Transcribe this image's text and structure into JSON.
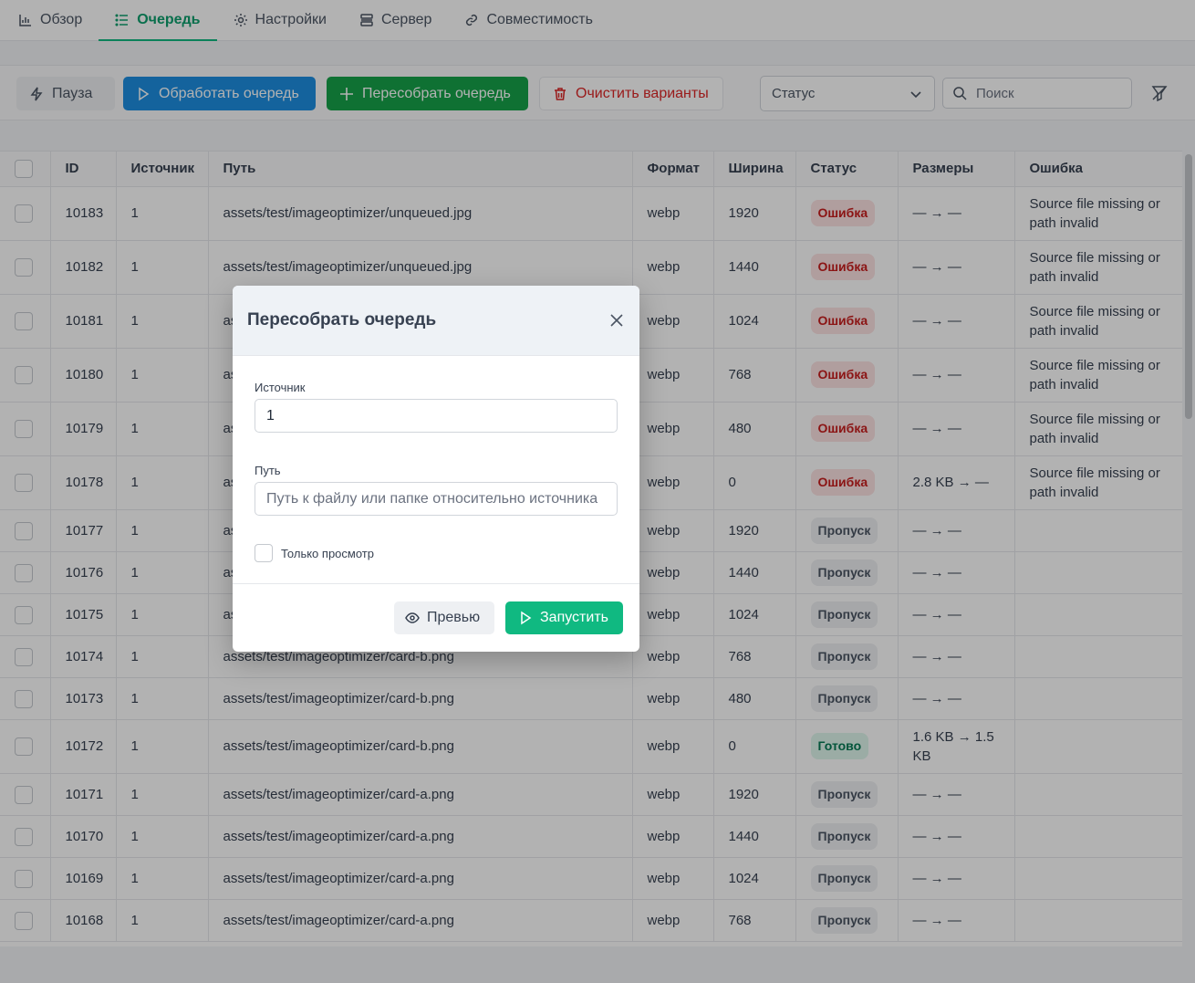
{
  "tabs": [
    {
      "label": "Обзор",
      "icon": "chart-icon",
      "active": false
    },
    {
      "label": "Очередь",
      "icon": "list-icon",
      "active": true
    },
    {
      "label": "Настройки",
      "icon": "gear-icon",
      "active": false
    },
    {
      "label": "Сервер",
      "icon": "server-icon",
      "active": false
    },
    {
      "label": "Совместимость",
      "icon": "link-icon",
      "active": false
    }
  ],
  "toolbar": {
    "pause_label": "Пауза",
    "process_label": "Обработать очередь",
    "rebuild_label": "Пересобрать очередь",
    "clear_label": "Очистить варианты",
    "status_placeholder": "Статус",
    "search_placeholder": "Поиск"
  },
  "table": {
    "columns": [
      "ID",
      "Источник",
      "Путь",
      "Формат",
      "Ширина",
      "Статус",
      "Размеры",
      "Ошибка"
    ],
    "rows": [
      {
        "id": "10183",
        "source": "1",
        "path": "assets/test/imageoptimizer/unqueued.jpg",
        "format": "webp",
        "width": "1920",
        "status": "Ошибка",
        "sizes": "— → —",
        "error": "Source file missing or path invalid"
      },
      {
        "id": "10182",
        "source": "1",
        "path": "assets/test/imageoptimizer/unqueued.jpg",
        "format": "webp",
        "width": "1440",
        "status": "Ошибка",
        "sizes": "— → —",
        "error": "Source file missing or path invalid"
      },
      {
        "id": "10181",
        "source": "1",
        "path": "as",
        "format": "webp",
        "width": "1024",
        "status": "Ошибка",
        "sizes": "— → —",
        "error": "Source file missing or path invalid"
      },
      {
        "id": "10180",
        "source": "1",
        "path": "as",
        "format": "webp",
        "width": "768",
        "status": "Ошибка",
        "sizes": "— → —",
        "error": "Source file missing or path invalid"
      },
      {
        "id": "10179",
        "source": "1",
        "path": "as",
        "format": "webp",
        "width": "480",
        "status": "Ошибка",
        "sizes": "— → —",
        "error": "Source file missing or path invalid"
      },
      {
        "id": "10178",
        "source": "1",
        "path": "as",
        "format": "webp",
        "width": "0",
        "status": "Ошибка",
        "sizes": "2.8 KB → —",
        "error": "Source file missing or path invalid"
      },
      {
        "id": "10177",
        "source": "1",
        "path": "as",
        "format": "webp",
        "width": "1920",
        "status": "Пропуск",
        "sizes": "— → —",
        "error": ""
      },
      {
        "id": "10176",
        "source": "1",
        "path": "as",
        "format": "webp",
        "width": "1440",
        "status": "Пропуск",
        "sizes": "— → —",
        "error": ""
      },
      {
        "id": "10175",
        "source": "1",
        "path": "as",
        "format": "webp",
        "width": "1024",
        "status": "Пропуск",
        "sizes": "— → —",
        "error": ""
      },
      {
        "id": "10174",
        "source": "1",
        "path": "assets/test/imageoptimizer/card-b.png",
        "format": "webp",
        "width": "768",
        "status": "Пропуск",
        "sizes": "— → —",
        "error": ""
      },
      {
        "id": "10173",
        "source": "1",
        "path": "assets/test/imageoptimizer/card-b.png",
        "format": "webp",
        "width": "480",
        "status": "Пропуск",
        "sizes": "— → —",
        "error": ""
      },
      {
        "id": "10172",
        "source": "1",
        "path": "assets/test/imageoptimizer/card-b.png",
        "format": "webp",
        "width": "0",
        "status": "Готово",
        "sizes": "1.6 KB → 1.5 KB",
        "error": ""
      },
      {
        "id": "10171",
        "source": "1",
        "path": "assets/test/imageoptimizer/card-a.png",
        "format": "webp",
        "width": "1920",
        "status": "Пропуск",
        "sizes": "— → —",
        "error": ""
      },
      {
        "id": "10170",
        "source": "1",
        "path": "assets/test/imageoptimizer/card-a.png",
        "format": "webp",
        "width": "1440",
        "status": "Пропуск",
        "sizes": "— → —",
        "error": ""
      },
      {
        "id": "10169",
        "source": "1",
        "path": "assets/test/imageoptimizer/card-a.png",
        "format": "webp",
        "width": "1024",
        "status": "Пропуск",
        "sizes": "— → —",
        "error": ""
      },
      {
        "id": "10168",
        "source": "1",
        "path": "assets/test/imageoptimizer/card-a.png",
        "format": "webp",
        "width": "768",
        "status": "Пропуск",
        "sizes": "— → —",
        "error": ""
      }
    ]
  },
  "modal": {
    "title": "Пересобрать очередь",
    "source_label": "Источник",
    "source_value": "1",
    "path_label": "Путь",
    "path_placeholder": "Путь к файлу или папке относительно источника",
    "preview_only_label": "Только просмотр",
    "preview_button": "Превью",
    "run_button": "Запустить"
  },
  "colors": {
    "accent_green": "#10b981",
    "primary_blue": "#1d8fe1",
    "danger_red": "#dc2626"
  }
}
